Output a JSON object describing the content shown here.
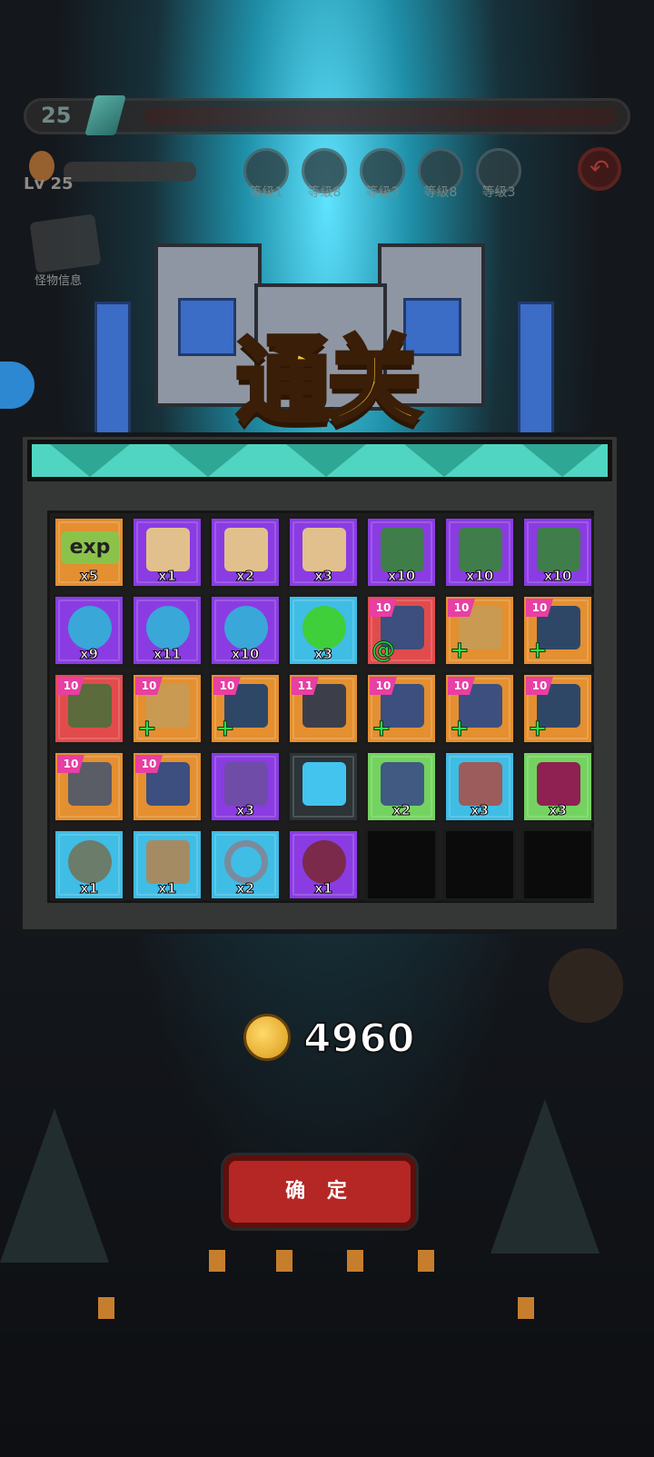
{
  "hud": {
    "player_level": "25",
    "hero_level": "Lv 25",
    "skills": [
      "等级1",
      "等级8",
      "等级3",
      "等级8",
      "等级3"
    ],
    "monster_info": "怪物信息"
  },
  "title": "通关",
  "rewards": [
    {
      "label": "exp",
      "qty": "x5",
      "bg": "orange",
      "icon": "exp-icon"
    },
    {
      "qty": "x1",
      "bg": "purple",
      "icon": "scroll-icon"
    },
    {
      "qty": "x2",
      "bg": "purple",
      "icon": "scroll-icon"
    },
    {
      "qty": "x3",
      "bg": "purple",
      "icon": "scroll-icon"
    },
    {
      "qty": "x10",
      "bg": "purple",
      "icon": "book-icon"
    },
    {
      "qty": "x10",
      "bg": "purple",
      "icon": "book-icon"
    },
    {
      "qty": "x10",
      "bg": "purple",
      "icon": "book-icon"
    },
    {
      "qty": "x9",
      "bg": "purple",
      "icon": "gear-icon"
    },
    {
      "qty": "x11",
      "bg": "purple",
      "icon": "gear-icon"
    },
    {
      "qty": "x10",
      "bg": "purple",
      "icon": "gear-icon"
    },
    {
      "qty": "x3",
      "bg": "cyan",
      "icon": "slime-icon"
    },
    {
      "tag": "10",
      "bg": "red",
      "icon": "boots-icon",
      "plus": "swirl"
    },
    {
      "tag": "10",
      "bg": "orange",
      "icon": "gloves-icon",
      "plus": "plus"
    },
    {
      "tag": "10",
      "bg": "orange",
      "icon": "robe-icon",
      "plus": "plus"
    },
    {
      "tag": "10",
      "bg": "red",
      "icon": "bracer-icon"
    },
    {
      "tag": "10",
      "bg": "orange",
      "icon": "gloves-icon",
      "plus": "plus"
    },
    {
      "tag": "10",
      "bg": "orange",
      "icon": "robe-icon",
      "plus": "plus"
    },
    {
      "tag": "11",
      "bg": "orange",
      "icon": "hood-icon"
    },
    {
      "tag": "10",
      "bg": "orange",
      "icon": "boots-icon",
      "plus": "plus"
    },
    {
      "tag": "10",
      "bg": "orange",
      "icon": "boots-icon",
      "plus": "plus"
    },
    {
      "tag": "10",
      "bg": "orange",
      "icon": "robe-icon",
      "plus": "plus"
    },
    {
      "tag": "10",
      "bg": "orange",
      "icon": "pants-icon"
    },
    {
      "tag": "10",
      "bg": "orange",
      "icon": "boots-icon"
    },
    {
      "qty": "x3",
      "bg": "purple",
      "icon": "dagger-icon"
    },
    {
      "bg": "dark",
      "icon": "cube-icon"
    },
    {
      "qty": "x2",
      "bg": "green",
      "icon": "tome-icon"
    },
    {
      "qty": "x3",
      "bg": "cyan",
      "icon": "claw-icon"
    },
    {
      "qty": "x3",
      "bg": "green",
      "icon": "pouch-icon"
    },
    {
      "qty": "x1",
      "bg": "cyan",
      "icon": "beetle-icon"
    },
    {
      "qty": "x1",
      "bg": "cyan",
      "icon": "sack-icon"
    },
    {
      "qty": "x2",
      "bg": "cyan",
      "icon": "ring-icon"
    },
    {
      "qty": "x1",
      "bg": "purple",
      "icon": "fruit-icon"
    },
    {
      "bg": "empty"
    },
    {
      "bg": "empty"
    },
    {
      "bg": "empty"
    }
  ],
  "coins": "4960",
  "confirm_label": "确 定"
}
